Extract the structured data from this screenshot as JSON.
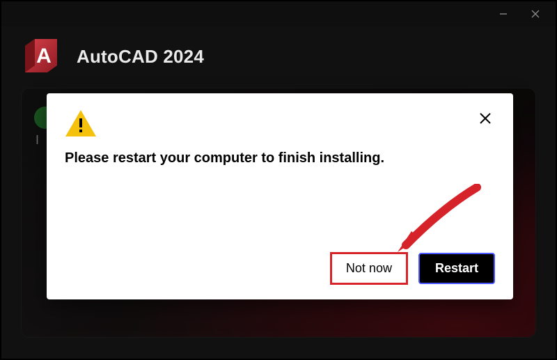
{
  "app": {
    "title": "AutoCAD 2024",
    "logo_letter": "A"
  },
  "window_controls": {
    "minimize_icon": "minimize",
    "close_icon": "close"
  },
  "background_card": {
    "hint_letter": "I"
  },
  "dialog": {
    "message": "Please restart your computer to finish installing.",
    "not_now_label": "Not now",
    "restart_label": "Restart"
  },
  "colors": {
    "accent_red": "#d52b2b",
    "logo_red": "#b3202a",
    "highlight_outline": "#d6232a",
    "restart_border": "#4a57ff"
  }
}
